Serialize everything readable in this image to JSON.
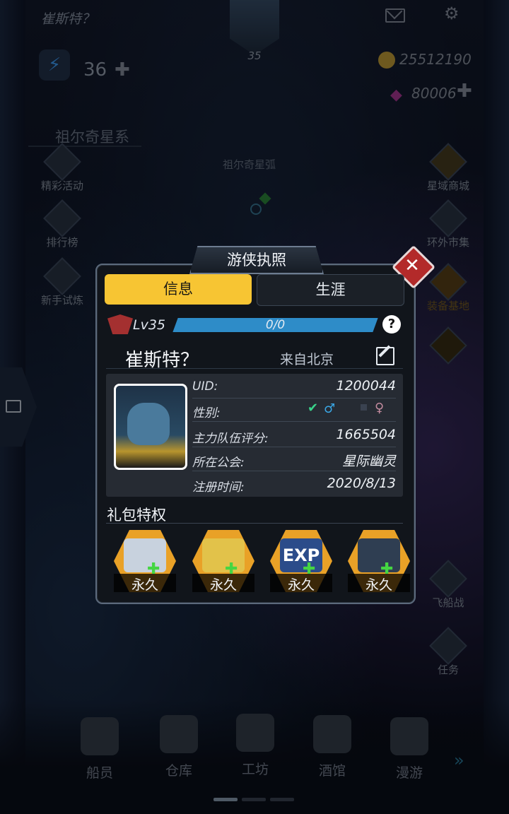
{
  "header": {
    "player_name": "崔斯特？",
    "avatar_level": "35",
    "energy": "36",
    "gold": "25512190",
    "gems": "80006"
  },
  "map": {
    "system_name": "祖尔奇星系",
    "arc_name": "祖尔奇星弧"
  },
  "left_menu": {
    "activities": "精彩活动",
    "ranking": "排行榜",
    "newbie_trial": "新手试炼"
  },
  "right_menu": {
    "star_shop": "星域商城",
    "outer_market": "环外市集",
    "equip_base": "装备基地",
    "ship_battle": "飞船战",
    "tasks": "任务"
  },
  "bottom_nav": {
    "crew": "船员",
    "warehouse": "仓库",
    "workshop": "工坊",
    "tavern": "酒馆",
    "roam": "漫游"
  },
  "dialog": {
    "title": "游侠执照",
    "tabs": {
      "info": "信息",
      "career": "生涯"
    },
    "level": "Lv35",
    "xp_text": "0/0",
    "help": "?",
    "player_name": "崔斯特？",
    "from": "来自北京",
    "fields": [
      {
        "label": "UID:",
        "value": "1200044"
      },
      {
        "label": "性别:",
        "value": ""
      },
      {
        "label": "主力队伍评分:",
        "value": "1665504"
      },
      {
        "label": "所在公会:",
        "value": "星际幽灵"
      },
      {
        "label": "注册时间:",
        "value": "2020/8/13"
      }
    ],
    "gender_male_symbol": "♂",
    "gender_female_symbol": "♀",
    "perk_title": "礼包特权",
    "perks": [
      {
        "label": "永久",
        "icon": "armor-icon"
      },
      {
        "label": "永久",
        "icon": "ap-bullet-icon"
      },
      {
        "label": "永久",
        "icon": "exp-card-icon"
      },
      {
        "label": "永久",
        "icon": "robot-part-icon"
      }
    ]
  }
}
